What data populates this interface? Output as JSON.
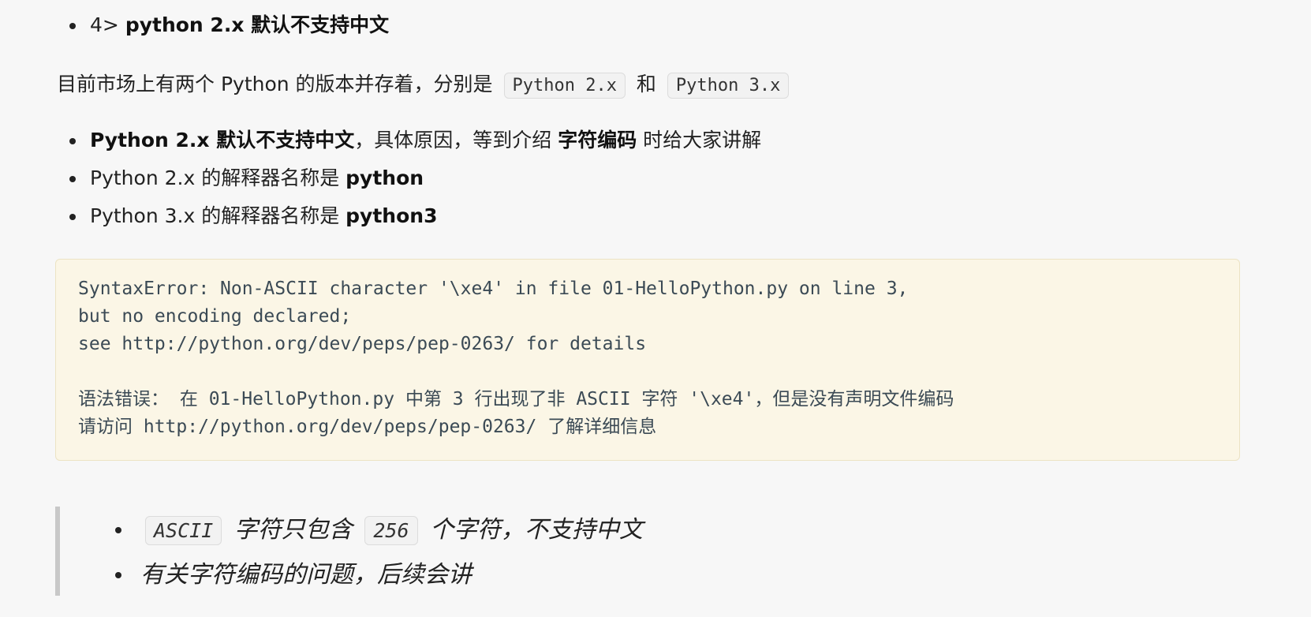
{
  "section_item": {
    "prefix": "4>",
    "title": "python 2.x 默认不支持中文"
  },
  "intro": {
    "text": "目前市场上有两个 Python 的版本并存着，分别是",
    "code1": "Python 2.x",
    "conj": "和",
    "code2": "Python 3.x"
  },
  "points": [
    {
      "bold1": "Python 2.x 默认不支持中文",
      "text1": "，具体原因，等到介绍",
      "bold2": "字符编码",
      "text2": "时给大家讲解"
    },
    {
      "text": "Python 2.x 的解释器名称是",
      "bold": "python"
    },
    {
      "text": "Python 3.x 的解释器名称是",
      "bold": "python3"
    }
  ],
  "code_block": {
    "lines": [
      "SyntaxError: Non-ASCII character '\\xe4' in file 01-HelloPython.py on line 3,",
      "but no encoding declared;",
      "see http://python.org/dev/peps/pep-0263/ for details",
      "",
      "语法错误： 在 01-HelloPython.py 中第 3 行出现了非 ASCII 字符 '\\xe4'，但是没有声明文件编码",
      "请访问 http://python.org/dev/peps/pep-0263/ 了解详细信息"
    ]
  },
  "quote": {
    "item1": {
      "code1": "ASCII",
      "text1": "字符只包含",
      "code2": "256",
      "text2": "个字符，不支持中文"
    },
    "item2": "有关字符编码的问题，后续会讲"
  }
}
